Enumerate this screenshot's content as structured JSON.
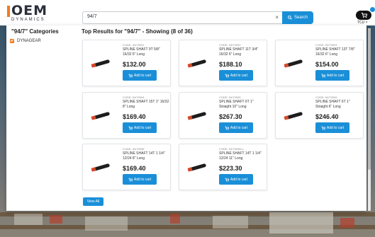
{
  "header": {
    "logo_main": "OEM",
    "logo_sub": "DYNAMICS",
    "search_value": "94/7",
    "search_clear": "×",
    "search_button": "Search",
    "cart_label": "TCU ×"
  },
  "sidebar": {
    "title": "\"94/7\" Categories",
    "items": [
      {
        "label": "DYNAGEAR",
        "checked": true
      }
    ]
  },
  "results": {
    "title": "Top Results for \"94/7\" - Showing (8 of 36)",
    "view_all": "View All",
    "add_to_cart": "Add to cart",
    "products": [
      {
        "code": "CODE: 94/70001",
        "name": "SPLINE SHAFT 9T 5/8\" 16/32 6\" Long",
        "price": "$132.00"
      },
      {
        "code": "CODE: 94/70002",
        "name": "SPLINE SHAFT 11T 3/4\" 16/32 6\" Long",
        "price": "$188.10"
      },
      {
        "code": "CODE: 94/70003",
        "name": "SPLINE SHAFT 13T 7/8\" 16/32 6\" Long",
        "price": "$154.00"
      },
      {
        "code": "CODE: 94/70004",
        "name": "SPLINE SHAFT 15T 1\" 16/32 8\" Long",
        "price": "$169.40"
      },
      {
        "code": "CODE: 94/70005",
        "name": "SPLINE SHAFT 6T 1\" Straight 10\" Long",
        "price": "$267.30"
      },
      {
        "code": "CODE: 94/70005",
        "name": "SPLINE SHAFT 6T 1\" Straight 6\" Long",
        "price": "$246.40"
      },
      {
        "code": "CODE: 94/70006",
        "name": "SPLINE SHAFT 14T 1 1/4\" 12/24 8\" Long",
        "price": "$169.40"
      },
      {
        "code": "CODE: 94/70006LL",
        "name": "SPLINE SHAFT 14T 1 1/4\" 12/24 11\" Long",
        "price": "$223.30"
      }
    ]
  },
  "colors": {
    "accent": "#1a8fd8",
    "brand_orange": "#f07b22"
  },
  "icons": {
    "search": "search-icon",
    "cart": "cart-icon",
    "add": "cart-icon"
  }
}
